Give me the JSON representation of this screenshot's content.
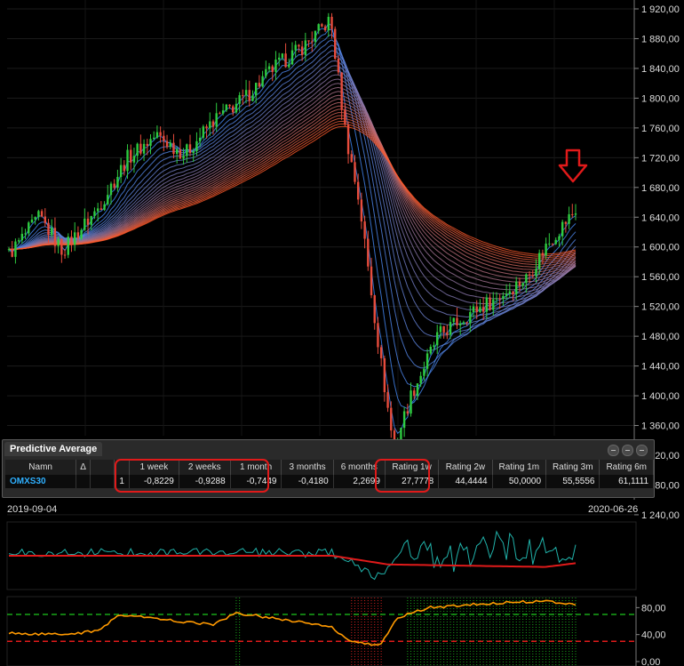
{
  "chart_data": [
    {
      "type": "line",
      "name": "price-chart",
      "x_range": [
        "2019-09-04",
        "2020-06-26"
      ],
      "ylim": [
        1290,
        1930
      ],
      "y_ticks": [
        "1 920,00",
        "1 880,00",
        "1 840,00",
        "1 800,00",
        "1 760,00",
        "1 720,00",
        "1 680,00",
        "1 640,00",
        "1 600,00",
        "1 560,00",
        "1 520,00",
        "1 480,00",
        "1 440,00",
        "1 400,00",
        "1 360,00",
        "1 320,00",
        "1 280,00",
        "1 240,00"
      ],
      "y_tick_values": [
        1920,
        1880,
        1840,
        1800,
        1760,
        1720,
        1680,
        1640,
        1600,
        1560,
        1520,
        1480,
        1440,
        1400,
        1360,
        1320,
        1280,
        1240
      ],
      "series": [
        {
          "values": [
            {
              "x": "2019-09-04",
              "y": 1590
            },
            {
              "x": "2019-09-20",
              "y": 1640
            },
            {
              "x": "2019-10-02",
              "y": 1595
            },
            {
              "x": "2019-10-20",
              "y": 1650
            },
            {
              "x": "2019-11-05",
              "y": 1720
            },
            {
              "x": "2019-11-20",
              "y": 1750
            },
            {
              "x": "2019-12-05",
              "y": 1725
            },
            {
              "x": "2019-12-20",
              "y": 1770
            },
            {
              "x": "2020-01-05",
              "y": 1800
            },
            {
              "x": "2020-01-20",
              "y": 1840
            },
            {
              "x": "2020-02-05",
              "y": 1870
            },
            {
              "x": "2020-02-19",
              "y": 1905
            },
            {
              "x": "2020-02-27",
              "y": 1750
            },
            {
              "x": "2020-03-05",
              "y": 1660
            },
            {
              "x": "2020-03-16",
              "y": 1450
            },
            {
              "x": "2020-03-23",
              "y": 1330
            },
            {
              "x": "2020-04-01",
              "y": 1400
            },
            {
              "x": "2020-04-15",
              "y": 1480
            },
            {
              "x": "2020-05-01",
              "y": 1510
            },
            {
              "x": "2020-05-15",
              "y": 1530
            },
            {
              "x": "2020-06-01",
              "y": 1560
            },
            {
              "x": "2020-06-10",
              "y": 1600
            },
            {
              "x": "2020-06-26",
              "y": 1650
            }
          ]
        }
      ],
      "colors": {
        "up": "#2ecc40",
        "down": "#e74c3c",
        "ribbon_long": "#ff5a2a",
        "ribbon_short": "#3d8bff",
        "arrow": "#e01a1a"
      }
    },
    {
      "type": "line",
      "name": "oscillator-chart",
      "series": [
        {
          "color": "#20b2aa",
          "values": [
            {
              "x": "2019-09-04",
              "y": 0.1
            },
            {
              "x": "2019-12-01",
              "y": 0.15
            },
            {
              "x": "2020-02-20",
              "y": 0.1
            },
            {
              "x": "2020-03-16",
              "y": -0.9
            },
            {
              "x": "2020-03-30",
              "y": 0.6
            },
            {
              "x": "2020-04-15",
              "y": -0.3
            },
            {
              "x": "2020-05-15",
              "y": 0.4
            },
            {
              "x": "2020-06-26",
              "y": 0.0
            }
          ]
        },
        {
          "color": "#e01a1a",
          "values": [
            {
              "x": "2019-09-04",
              "y": 0.0
            },
            {
              "x": "2020-02-20",
              "y": 0.0
            },
            {
              "x": "2020-03-20",
              "y": -0.35
            },
            {
              "x": "2020-06-10",
              "y": -0.45
            },
            {
              "x": "2020-06-26",
              "y": -0.3
            }
          ]
        }
      ]
    },
    {
      "type": "line",
      "name": "rating-chart",
      "ylim": [
        0,
        95
      ],
      "y_ticks": [
        "80,00",
        "40,00",
        "0,00"
      ],
      "y_tick_values": [
        80,
        40,
        0
      ],
      "thresholds": [
        70,
        30
      ],
      "series": [
        {
          "color": "#ff9900",
          "values": [
            {
              "x": "2019-09-04",
              "y": 42
            },
            {
              "x": "2019-10-01",
              "y": 40
            },
            {
              "x": "2019-10-20",
              "y": 45
            },
            {
              "x": "2019-11-01",
              "y": 70
            },
            {
              "x": "2019-12-01",
              "y": 60
            },
            {
              "x": "2019-12-20",
              "y": 55
            },
            {
              "x": "2020-01-01",
              "y": 72
            },
            {
              "x": "2020-02-01",
              "y": 60
            },
            {
              "x": "2020-02-20",
              "y": 50
            },
            {
              "x": "2020-03-01",
              "y": 28
            },
            {
              "x": "2020-03-16",
              "y": 25
            },
            {
              "x": "2020-03-25",
              "y": 65
            },
            {
              "x": "2020-04-10",
              "y": 80
            },
            {
              "x": "2020-05-10",
              "y": 86
            },
            {
              "x": "2020-06-10",
              "y": 90
            },
            {
              "x": "2020-06-26",
              "y": 85
            }
          ]
        }
      ]
    }
  ],
  "panel": {
    "title": "Predictive Average",
    "headers": {
      "name": "Namn",
      "sort": "Δ",
      "w1": "1 week",
      "w2": "2 weeks",
      "m1": "1 month",
      "m3": "3 months",
      "m6": "6 months",
      "r1w": "Rating 1w",
      "r2w": "Rating 2w",
      "r1m": "Rating 1m",
      "r3m": "Rating 3m",
      "r6m": "Rating 6m"
    },
    "row": {
      "index": "1",
      "name": "OMXS30",
      "w1": "-0,8229",
      "w2": "-0,9288",
      "m1": "-0,7449",
      "m3": "-0,4180",
      "m6": "2,2699",
      "r1w": "27,7778",
      "r2w": "44,4444",
      "r1m": "50,0000",
      "r3m": "55,5556",
      "r6m": "61,1111"
    }
  },
  "dates": {
    "start": "2019-09-04",
    "end": "2020-06-26"
  }
}
